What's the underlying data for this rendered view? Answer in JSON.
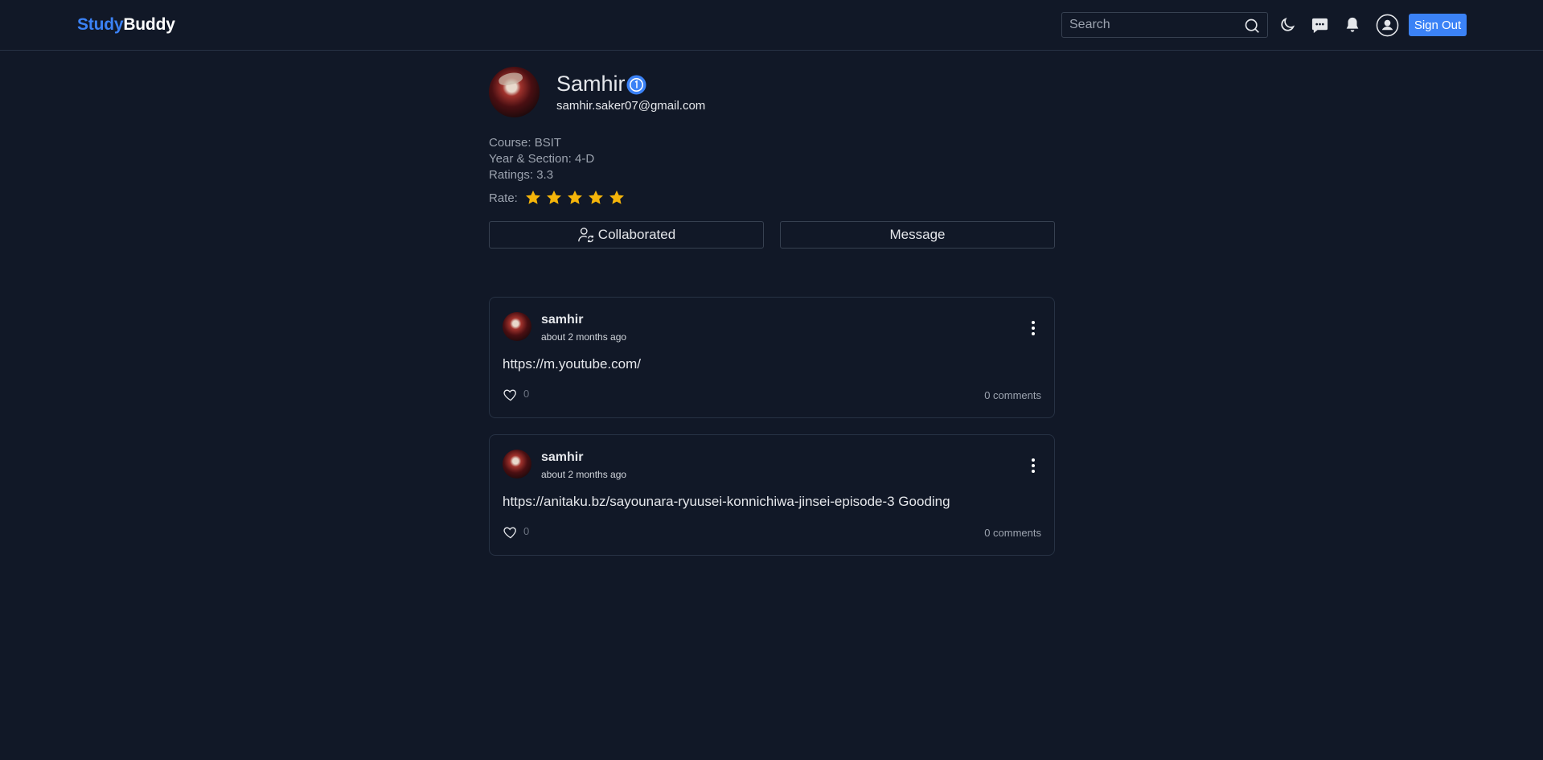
{
  "header": {
    "logo_part1": "Study",
    "logo_part2": "Buddy",
    "search_placeholder": "Search",
    "signout_label": "Sign Out",
    "icons": [
      "search-icon",
      "moon-icon",
      "chat-icon",
      "bell-icon",
      "user-icon"
    ]
  },
  "profile": {
    "name": "Samhir",
    "email": "samhir.saker07@gmail.com",
    "course": "Course: BSIT",
    "year_section": "Year & Section: 4-D",
    "ratings": "Ratings: 3.3",
    "rate_label": "Rate:",
    "rate_stars": 5,
    "collaborated_label": "Collaborated",
    "message_label": "Message",
    "colors": {
      "accent": "#3b82f6",
      "star": "#f5b50a",
      "background": "#111827"
    }
  },
  "posts": [
    {
      "author": "samhir",
      "time": "about 2 months ago",
      "body": "https://m.youtube.com/",
      "likes": "0",
      "comments": "0 comments"
    },
    {
      "author": "samhir",
      "time": "about 2 months ago",
      "body": "https://anitaku.bz/sayounara-ryuusei-konnichiwa-jinsei-episode-3 Gooding",
      "likes": "0",
      "comments": "0 comments"
    }
  ]
}
